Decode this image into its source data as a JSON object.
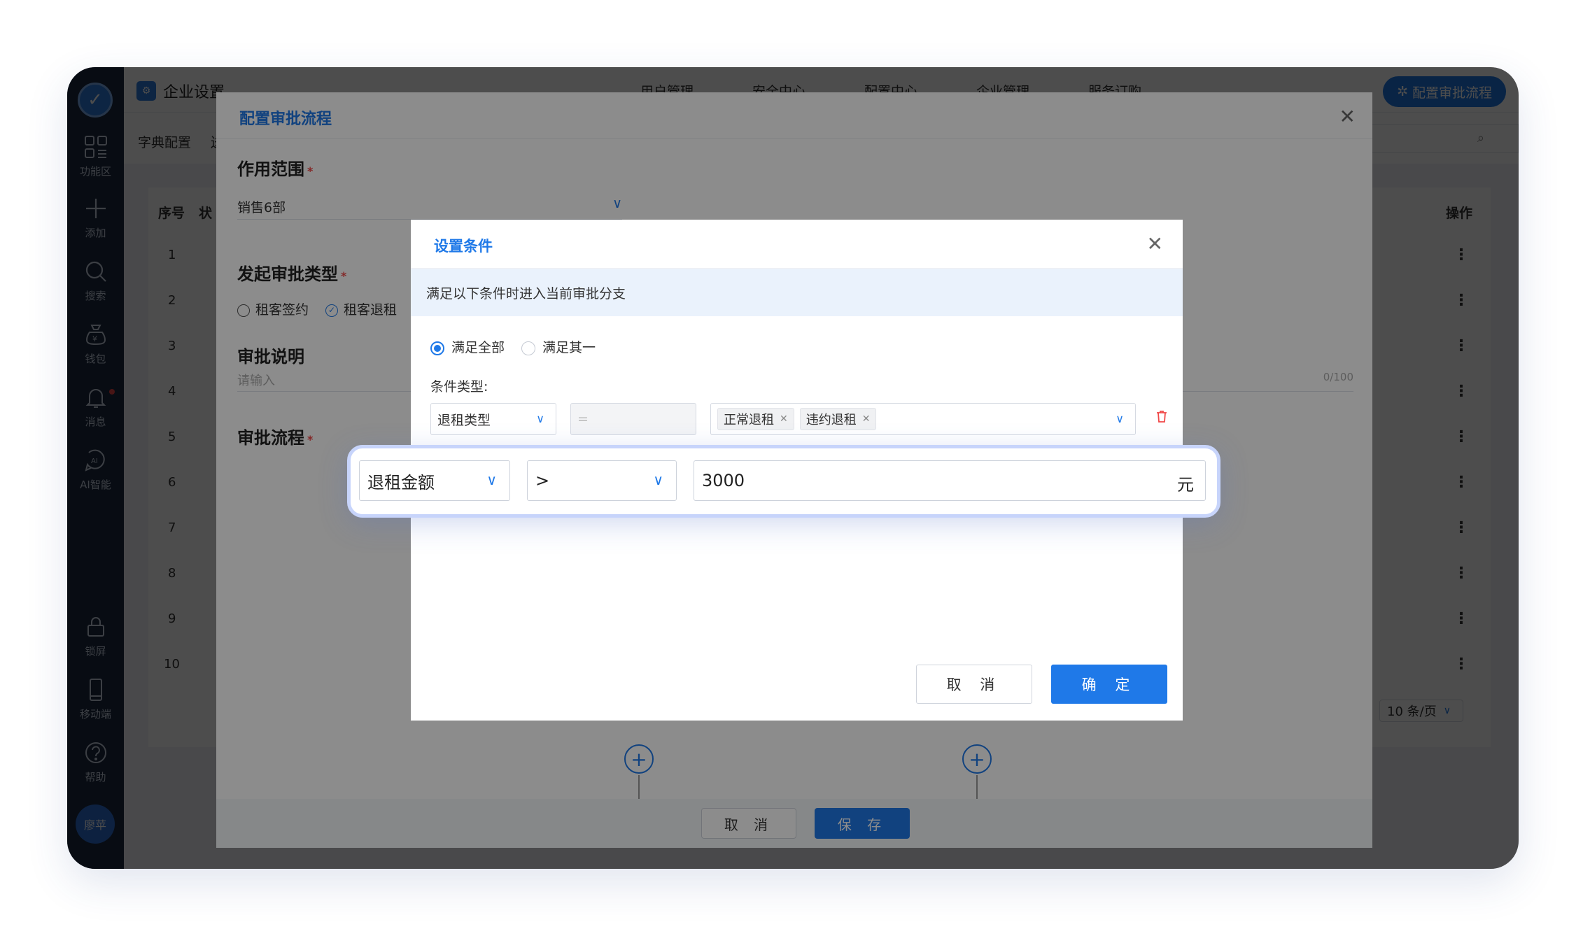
{
  "rail": {
    "items": [
      {
        "label": "功能区",
        "icon": "grid-icon"
      },
      {
        "label": "添加",
        "icon": "plus-icon"
      },
      {
        "label": "搜索",
        "icon": "search-icon"
      },
      {
        "label": "钱包",
        "icon": "wallet-icon"
      },
      {
        "label": "消息",
        "icon": "bell-icon"
      },
      {
        "label": "AI智能",
        "icon": "ai-icon"
      },
      {
        "label": "锁屏",
        "icon": "lock-icon"
      },
      {
        "label": "移动端",
        "icon": "mobile-icon"
      },
      {
        "label": "帮助",
        "icon": "help-icon"
      }
    ],
    "avatar": "廖苹"
  },
  "header": {
    "title": "企业设置",
    "nav": [
      "用户管理",
      "安全中心",
      "配置中心",
      "企业管理",
      "服务订购"
    ],
    "cta": "配置审批流程"
  },
  "subbar": {
    "tabs": [
      "字典配置",
      "送"
    ]
  },
  "table": {
    "headers": {
      "index": "序号",
      "status": "状",
      "ops": "操作"
    },
    "rows": [
      "1",
      "2",
      "3",
      "4",
      "5",
      "6",
      "7",
      "8",
      "9",
      "10"
    ],
    "op_glyph": "⋮",
    "page_size": "10 条/页"
  },
  "drawer": {
    "title": "配置审批流程",
    "scope_label": "作用范围",
    "scope_value": "销售6部",
    "type_label": "发起审批类型",
    "type_options": [
      "租客签约",
      "租客退租"
    ],
    "type_checked": "租客退租",
    "desc_label": "审批说明",
    "desc_placeholder": "请输入",
    "desc_count": "0/100",
    "flow_label": "审批流程",
    "cancel": "取 消",
    "save": "保 存"
  },
  "modal": {
    "title": "设置条件",
    "tip": "满足以下条件时进入当前审批分支",
    "match_all": "满足全部",
    "match_any": "满足其一",
    "cond_label": "条件类型:",
    "row1": {
      "field": "退租类型",
      "op": "=",
      "tags": [
        "正常退租",
        "违约退租"
      ]
    },
    "cancel": "取 消",
    "ok": "确 定"
  },
  "highlight_row": {
    "field": "退租金额",
    "op": ">",
    "value": "3000",
    "unit": "元"
  },
  "colors": {
    "accent": "#1f79e8",
    "rail": "#1c2b43",
    "danger": "#f04848",
    "highlight_border": "#c7d4fb"
  }
}
